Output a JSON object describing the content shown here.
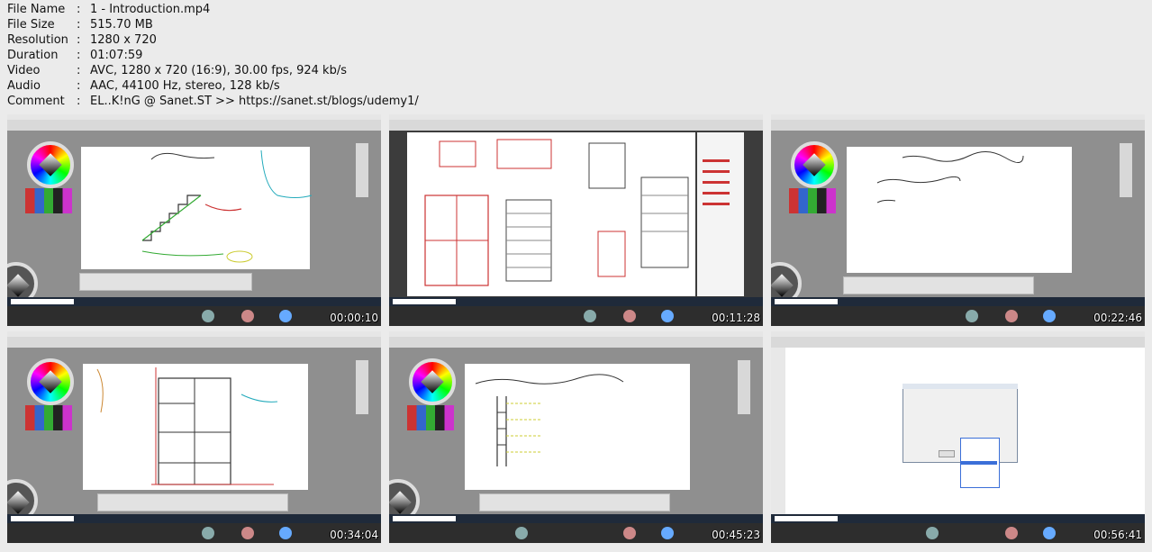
{
  "file_info": [
    {
      "key": "File Name",
      "value": "1 - Introduction.mp4"
    },
    {
      "key": "File Size",
      "value": "515.70 MB"
    },
    {
      "key": "Resolution",
      "value": "1280 x 720"
    },
    {
      "key": "Duration",
      "value": "01:07:59"
    },
    {
      "key": "Video",
      "value": "AVC, 1280 x 720 (16:9), 30.00 fps, 924 kb/s"
    },
    {
      "key": "Audio",
      "value": "AAC, 44100 Hz, stereo, 128 kb/s"
    },
    {
      "key": "Comment",
      "value": "EL..K!nG @ Sanet.ST >> https://sanet.st/blogs/udemy1/"
    }
  ],
  "separator": ":",
  "thumbnails": [
    {
      "timestamp": "00:00:10",
      "scene": "whiteboard-staircase-sketch"
    },
    {
      "timestamp": "00:11:28",
      "scene": "pdf-floor-plan-drawing"
    },
    {
      "timestamp": "00:22:46",
      "scene": "whiteboard-handwritten-notes"
    },
    {
      "timestamp": "00:34:04",
      "scene": "whiteboard-floor-plan-sketch"
    },
    {
      "timestamp": "00:45:23",
      "scene": "whiteboard-storey-sketch"
    },
    {
      "timestamp": "00:56:41",
      "scene": "software-dialog"
    }
  ]
}
